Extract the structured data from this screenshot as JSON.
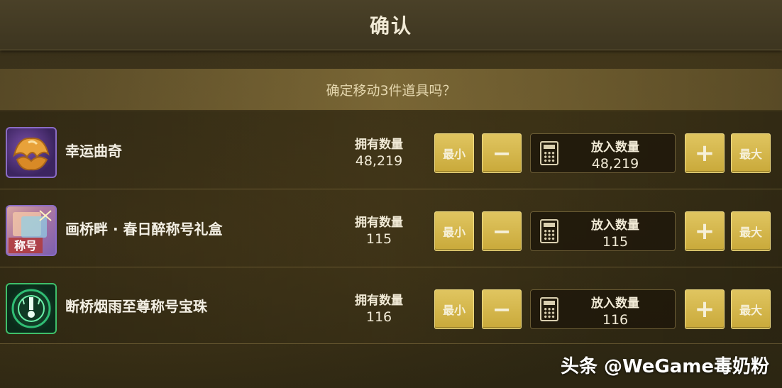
{
  "dialog": {
    "title": "确认",
    "question": "确定移动3件道具吗？"
  },
  "labels": {
    "owned": "拥有数量",
    "put": "放入数量",
    "min": "最小",
    "max": "最大",
    "minus": "−",
    "plus": "+"
  },
  "items": [
    {
      "name": "幸运曲奇",
      "owned": "48,219",
      "put": "48,219",
      "icon": "fortune-cookie-icon"
    },
    {
      "name": "画桥畔 · 春日醉称号礼盒",
      "owned": "115",
      "put": "115",
      "icon": "title-gift-box-icon",
      "badge": "称号"
    },
    {
      "name": "断桥烟雨至尊称号宝珠",
      "owned": "116",
      "put": "116",
      "icon": "title-orb-icon"
    }
  ],
  "watermark": "头条 @WeGame毒奶粉"
}
